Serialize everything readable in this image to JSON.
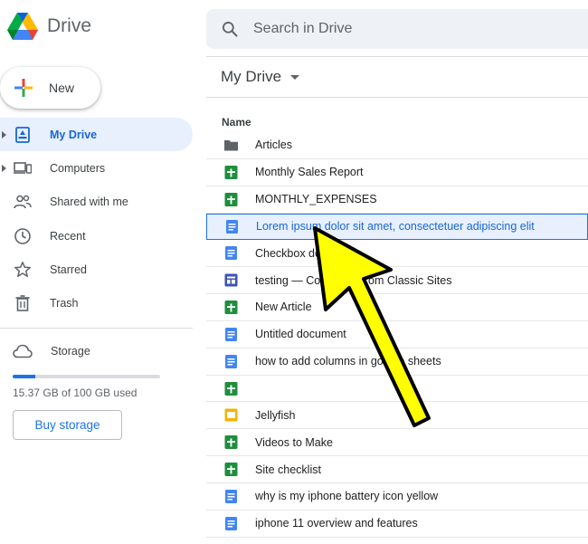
{
  "app": {
    "name": "Drive"
  },
  "search": {
    "placeholder": "Search in Drive"
  },
  "new_button": {
    "label": "New"
  },
  "sidebar": {
    "items": [
      {
        "label": "My Drive",
        "icon": "my-drive-icon",
        "active": true,
        "expandable": true
      },
      {
        "label": "Computers",
        "icon": "computers-icon",
        "active": false,
        "expandable": true
      },
      {
        "label": "Shared with me",
        "icon": "shared-icon",
        "active": false,
        "expandable": false
      },
      {
        "label": "Recent",
        "icon": "clock-icon",
        "active": false,
        "expandable": false
      },
      {
        "label": "Starred",
        "icon": "star-icon",
        "active": false,
        "expandable": false
      },
      {
        "label": "Trash",
        "icon": "trash-icon",
        "active": false,
        "expandable": false
      }
    ],
    "storage": {
      "label": "Storage",
      "used_text": "15.37 GB of 100 GB used",
      "used_fraction": 0.154,
      "buy_label": "Buy storage"
    }
  },
  "main": {
    "title": "My Drive",
    "column_header": "Name",
    "files": [
      {
        "name": "Articles",
        "type": "folder"
      },
      {
        "name": "Monthly Sales Report",
        "type": "sheet"
      },
      {
        "name": "MONTHLY_EXPENSES",
        "type": "sheet"
      },
      {
        "name": "Lorem ipsum dolor sit amet, consectetuer adipiscing elit",
        "type": "doc",
        "selected": true
      },
      {
        "name": "Checkbox document",
        "type": "doc"
      },
      {
        "name": "testing — Converted from Classic Sites",
        "type": "site"
      },
      {
        "name": "New Article",
        "type": "sheet"
      },
      {
        "name": "Untitled document",
        "type": "doc"
      },
      {
        "name": "how to add columns in google sheets",
        "type": "doc"
      },
      {
        "name": "",
        "type": "sheet"
      },
      {
        "name": "Jellyfish",
        "type": "slides"
      },
      {
        "name": "Videos to Make",
        "type": "sheet"
      },
      {
        "name": "Site checklist",
        "type": "sheet"
      },
      {
        "name": "why is my iphone battery icon yellow",
        "type": "doc"
      },
      {
        "name": "iphone 11 overview and features",
        "type": "doc"
      }
    ]
  },
  "colors": {
    "accent": "#1a73e8",
    "active_bg": "#e8f0fe",
    "sheet": "#1e8e3e",
    "doc": "#4285f4",
    "slides": "#f4b400",
    "site": "#3f51b5",
    "folder": "#5f6368",
    "annotation_arrow": "#ffff00"
  }
}
